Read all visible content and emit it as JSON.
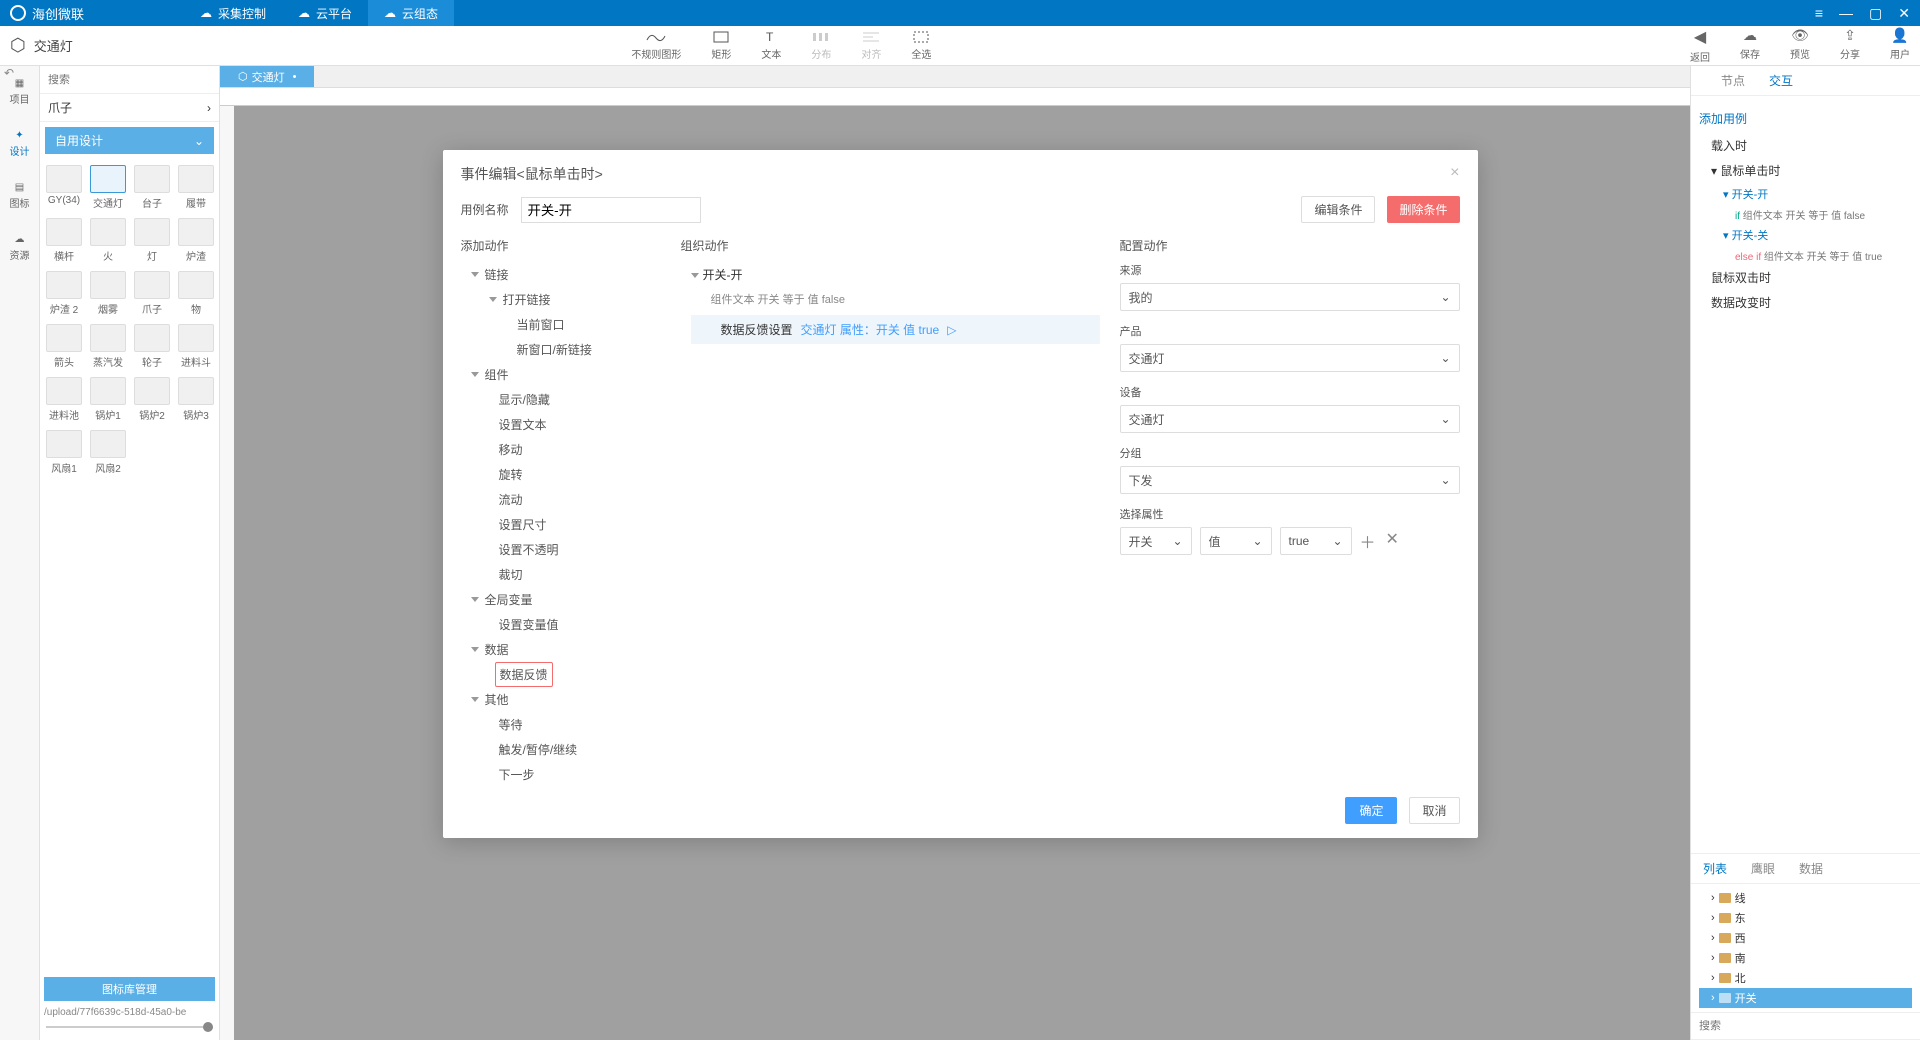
{
  "titlebar": {
    "brand": "海创微联",
    "tabs": [
      "采集控制",
      "云平台",
      "云组态"
    ]
  },
  "toolbar": {
    "doc_title": "交通灯",
    "center": [
      "不规则图形",
      "矩形",
      "文本",
      "分布",
      "对齐",
      "全选"
    ],
    "right": [
      "返回",
      "保存",
      "预览",
      "分享",
      "用户"
    ]
  },
  "left_rail": [
    "项目",
    "设计",
    "图标",
    "资源"
  ],
  "components": {
    "search_placeholder": "搜索",
    "breadcrumb": "爪子",
    "category": "自用设计",
    "items": [
      "GY(34)",
      "交通灯",
      "台子",
      "履带",
      "横杆",
      "火",
      "灯",
      "炉渣",
      "炉渣 2",
      "烟雾",
      "爪子",
      "物",
      "箭头",
      "蒸汽发",
      "轮子",
      "进料斗",
      "进料池",
      "锅炉1",
      "锅炉2",
      "锅炉3",
      "风扇1",
      "风扇2"
    ],
    "iconlib_btn": "图标库管理",
    "upload_path": "/upload/77f6639c-518d-45a0-be"
  },
  "canvas": {
    "tab": "交通灯"
  },
  "right_panel": {
    "tabs": [
      "节点",
      "交互"
    ],
    "add_case": "添加用例",
    "events": {
      "load": "载入时",
      "click": "鼠标单击时",
      "dblclick": "鼠标双击时",
      "datachange": "数据改变时"
    },
    "cases": [
      {
        "name": "开关-开",
        "cond": {
          "kw": "if",
          "text": " 组件文本 开关 等于 值 false"
        }
      },
      {
        "name": "开关-关",
        "cond": {
          "kw": "else if",
          "text": " 组件文本 开关 等于 值 true"
        }
      }
    ],
    "bottom_tabs": [
      "列表",
      "鹰眼",
      "数据"
    ],
    "layers": [
      "线",
      "东",
      "西",
      "南",
      "北",
      "开关"
    ],
    "bottom_search": "搜索"
  },
  "modal": {
    "title": "事件编辑<鼠标单击时>",
    "case_label": "用例名称",
    "case_value": "开关-开",
    "edit_cond_btn": "编辑条件",
    "del_cond_btn": "删除条件",
    "add_action_h": "添加动作",
    "org_action_h": "组织动作",
    "config_h": "配置动作",
    "tree": {
      "link": "链接",
      "open_link": "打开链接",
      "cur_win": "当前窗口",
      "new_win": "新窗口/新链接",
      "component": "组件",
      "show_hide": "显示/隐藏",
      "set_text": "设置文本",
      "move": "移动",
      "rotate": "旋转",
      "flow": "流动",
      "set_size": "设置尺寸",
      "set_opacity": "设置不透明",
      "crop": "裁切",
      "global_var": "全局变量",
      "set_var": "设置变量值",
      "data": "数据",
      "data_feedback": "数据反馈",
      "other": "其他",
      "wait": "等待",
      "trigger": "触发/暂停/继续",
      "next": "下一步"
    },
    "org": {
      "group": "开关-开",
      "cond": "组件文本 开关 等于 值 false",
      "action_label": "数据反馈设置",
      "action_blue": "交通灯 属性：开关 值 true"
    },
    "config": {
      "source_l": "来源",
      "source_v": "我的",
      "product_l": "产品",
      "product_v": "交通灯",
      "device_l": "设备",
      "device_v": "交通灯",
      "group_l": "分组",
      "group_v": "下发",
      "attr_l": "选择属性",
      "attr_v": "开关",
      "val_v": "值",
      "bool_v": "true"
    },
    "ok_btn": "确定",
    "cancel_btn": "取消"
  }
}
